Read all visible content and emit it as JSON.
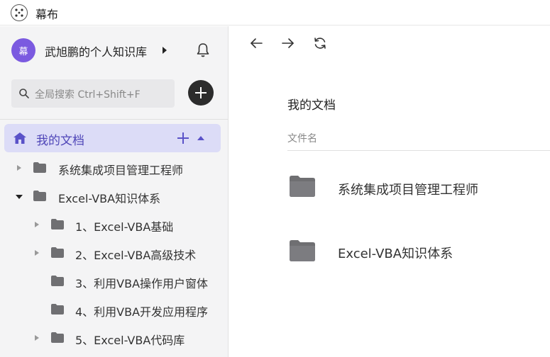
{
  "app": {
    "title": "幕布"
  },
  "sidebar": {
    "avatar_text": "幕",
    "knowledge_base_name": "武旭鹏的个人知识库",
    "search_placeholder": "全局搜索 Ctrl+Shift+F",
    "root_label": "我的文档",
    "tree": [
      {
        "label": "系统集成项目管理工程师",
        "level": 0,
        "expander": "collapsed"
      },
      {
        "label": "Excel-VBA知识体系",
        "level": 0,
        "expander": "expanded"
      },
      {
        "label": "1、Excel-VBA基础",
        "level": 1,
        "expander": "collapsed"
      },
      {
        "label": "2、Excel-VBA高级技术",
        "level": 1,
        "expander": "collapsed"
      },
      {
        "label": "3、利用VBA操作用户窗体",
        "level": 1,
        "expander": "none"
      },
      {
        "label": "4、利用VBA开发应用程序",
        "level": 1,
        "expander": "none"
      },
      {
        "label": "5、Excel-VBA代码库",
        "level": 1,
        "expander": "collapsed"
      }
    ]
  },
  "main": {
    "title": "我的文档",
    "column_header": "文件名",
    "items": [
      {
        "label": "系统集成项目管理工程师"
      },
      {
        "label": "Excel-VBA知识体系"
      }
    ]
  },
  "colors": {
    "accent": "#5a52c8",
    "selected_bg": "#dcdcf7",
    "avatar_bg": "#7b5ae0",
    "sidebar_bg": "#f4f4f5",
    "folder": "#6f6f72"
  },
  "icons": [
    "mubu-logo-icon",
    "bell-icon",
    "search-icon",
    "plus-icon",
    "home-icon",
    "folder-icon",
    "arrow-left-icon",
    "arrow-right-icon",
    "refresh-icon"
  ]
}
